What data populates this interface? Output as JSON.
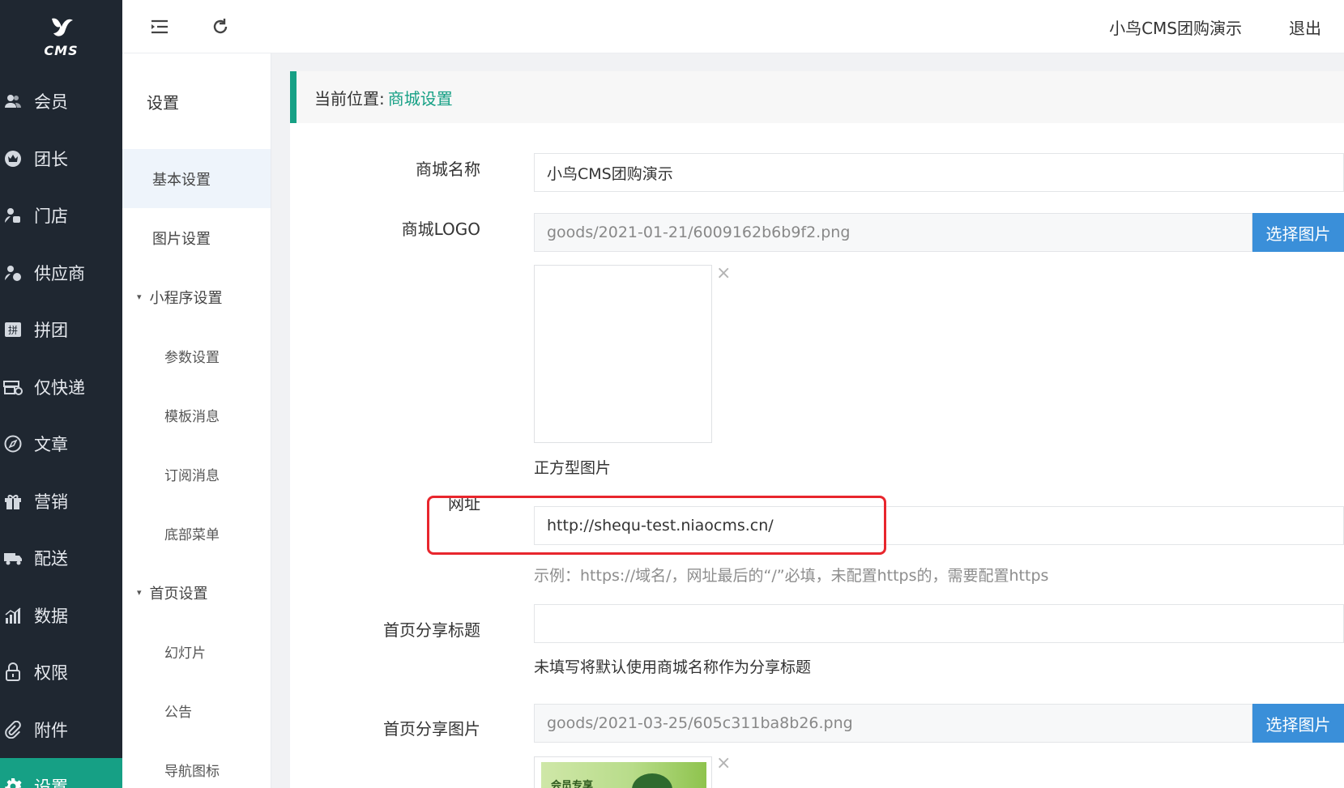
{
  "sidebar": {
    "logo_text": "CMS",
    "items": [
      {
        "label": "会员",
        "icon": "users-icon"
      },
      {
        "label": "团长",
        "icon": "crown-icon"
      },
      {
        "label": "门店",
        "icon": "store-user-icon"
      },
      {
        "label": "供应商",
        "icon": "supplier-icon"
      },
      {
        "label": "拼团",
        "icon": "group-buy-icon"
      },
      {
        "label": "仅快递",
        "icon": "express-icon"
      },
      {
        "label": "文章",
        "icon": "compass-icon"
      },
      {
        "label": "营销",
        "icon": "gift-icon"
      },
      {
        "label": "配送",
        "icon": "truck-icon"
      },
      {
        "label": "数据",
        "icon": "bar-chart-icon"
      },
      {
        "label": "权限",
        "icon": "lock-icon"
      },
      {
        "label": "附件",
        "icon": "paperclip-icon"
      },
      {
        "label": "设置",
        "icon": "gear-icon"
      }
    ],
    "active_index": 12
  },
  "topbar": {
    "shop_name": "小鸟CMS团购演示",
    "logout": "退出"
  },
  "submenu": {
    "title": "设置",
    "items": [
      {
        "label": "基本设置",
        "type": "item",
        "active": true
      },
      {
        "label": "图片设置",
        "type": "item"
      },
      {
        "label": "小程序设置",
        "type": "group"
      },
      {
        "label": "参数设置",
        "type": "sub"
      },
      {
        "label": "模板消息",
        "type": "sub"
      },
      {
        "label": "订阅消息",
        "type": "sub"
      },
      {
        "label": "底部菜单",
        "type": "sub"
      },
      {
        "label": "首页设置",
        "type": "group"
      },
      {
        "label": "幻灯片",
        "type": "sub"
      },
      {
        "label": "公告",
        "type": "sub"
      },
      {
        "label": "导航图标",
        "type": "sub"
      }
    ]
  },
  "breadcrumb": {
    "prefix": "当前位置:",
    "current": "商城设置"
  },
  "form": {
    "shop_name_label": "商城名称",
    "shop_name_value": "小鸟CMS团购演示",
    "logo_label": "商城LOGO",
    "logo_value": "goods/2021-01-21/6009162b6b9f2.png",
    "logo_button": "选择图片",
    "logo_hint": "正方型图片",
    "url_label": "网址",
    "url_value": "http://shequ-test.niaocms.cn/",
    "url_hint": "示例：https://域名/，网址最后的“/”必填，未配置https的，需要配置https",
    "share_title_label": "首页分享标题",
    "share_title_value": "",
    "share_title_hint": "未填写将默认使用商城名称作为分享标题",
    "share_image_label": "首页分享图片",
    "share_image_value": "goods/2021-03-25/605c311ba8b26.png",
    "share_image_button": "选择图片",
    "share_image_thumb_text": "会员专享",
    "close_glyph": "×"
  },
  "colors": {
    "sidebar_bg": "#1f2731",
    "accent": "#16a085",
    "button_blue": "#3a8fd9",
    "highlight_red": "#e8262d"
  }
}
